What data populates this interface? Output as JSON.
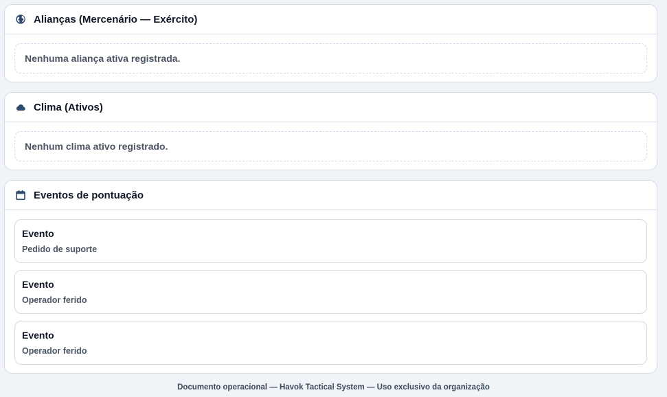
{
  "alliances": {
    "title": "Alianças (Mercenário — Exército)",
    "icon": "globe-icon",
    "empty_text": "Nenhuma aliança ativa registrada."
  },
  "climate": {
    "title": "Clima (Ativos)",
    "icon": "cloud-icon",
    "empty_text": "Nenhum clima ativo registrado."
  },
  "events": {
    "title": "Eventos de pontuação",
    "icon": "calendar-icon",
    "items": [
      {
        "title": "Evento",
        "description": "Pedido de suporte"
      },
      {
        "title": "Evento",
        "description": "Operador ferido"
      },
      {
        "title": "Evento",
        "description": "Operador ferido"
      }
    ]
  },
  "footer": {
    "text": "Documento operacional — Havok Tactical System — Uso exclusivo da organização"
  },
  "colors": {
    "icon": "#2f4a6d",
    "background": "#f0f3f7",
    "card": "#ffffff"
  }
}
